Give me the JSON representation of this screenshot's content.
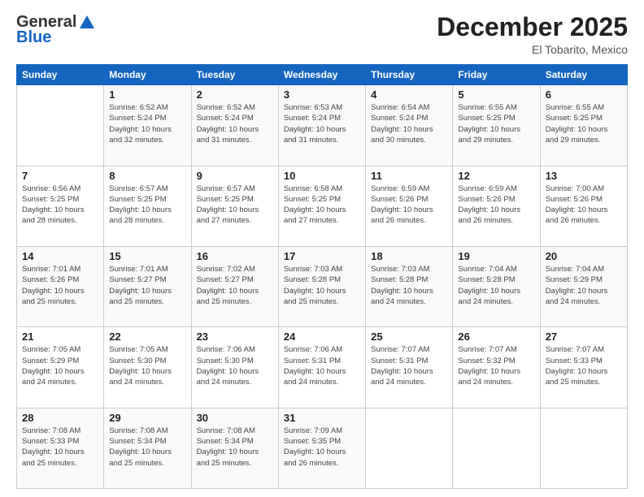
{
  "logo": {
    "general": "General",
    "blue": "Blue"
  },
  "header": {
    "title": "December 2025",
    "subtitle": "El Tobarito, Mexico"
  },
  "weekdays": [
    "Sunday",
    "Monday",
    "Tuesday",
    "Wednesday",
    "Thursday",
    "Friday",
    "Saturday"
  ],
  "weeks": [
    [
      {
        "day": "",
        "sunrise": "",
        "sunset": "",
        "daylight": ""
      },
      {
        "day": "1",
        "sunrise": "Sunrise: 6:52 AM",
        "sunset": "Sunset: 5:24 PM",
        "daylight": "Daylight: 10 hours and 32 minutes."
      },
      {
        "day": "2",
        "sunrise": "Sunrise: 6:52 AM",
        "sunset": "Sunset: 5:24 PM",
        "daylight": "Daylight: 10 hours and 31 minutes."
      },
      {
        "day": "3",
        "sunrise": "Sunrise: 6:53 AM",
        "sunset": "Sunset: 5:24 PM",
        "daylight": "Daylight: 10 hours and 31 minutes."
      },
      {
        "day": "4",
        "sunrise": "Sunrise: 6:54 AM",
        "sunset": "Sunset: 5:24 PM",
        "daylight": "Daylight: 10 hours and 30 minutes."
      },
      {
        "day": "5",
        "sunrise": "Sunrise: 6:55 AM",
        "sunset": "Sunset: 5:25 PM",
        "daylight": "Daylight: 10 hours and 29 minutes."
      },
      {
        "day": "6",
        "sunrise": "Sunrise: 6:55 AM",
        "sunset": "Sunset: 5:25 PM",
        "daylight": "Daylight: 10 hours and 29 minutes."
      }
    ],
    [
      {
        "day": "7",
        "sunrise": "Sunrise: 6:56 AM",
        "sunset": "Sunset: 5:25 PM",
        "daylight": "Daylight: 10 hours and 28 minutes."
      },
      {
        "day": "8",
        "sunrise": "Sunrise: 6:57 AM",
        "sunset": "Sunset: 5:25 PM",
        "daylight": "Daylight: 10 hours and 28 minutes."
      },
      {
        "day": "9",
        "sunrise": "Sunrise: 6:57 AM",
        "sunset": "Sunset: 5:25 PM",
        "daylight": "Daylight: 10 hours and 27 minutes."
      },
      {
        "day": "10",
        "sunrise": "Sunrise: 6:58 AM",
        "sunset": "Sunset: 5:25 PM",
        "daylight": "Daylight: 10 hours and 27 minutes."
      },
      {
        "day": "11",
        "sunrise": "Sunrise: 6:59 AM",
        "sunset": "Sunset: 5:26 PM",
        "daylight": "Daylight: 10 hours and 26 minutes."
      },
      {
        "day": "12",
        "sunrise": "Sunrise: 6:59 AM",
        "sunset": "Sunset: 5:26 PM",
        "daylight": "Daylight: 10 hours and 26 minutes."
      },
      {
        "day": "13",
        "sunrise": "Sunrise: 7:00 AM",
        "sunset": "Sunset: 5:26 PM",
        "daylight": "Daylight: 10 hours and 26 minutes."
      }
    ],
    [
      {
        "day": "14",
        "sunrise": "Sunrise: 7:01 AM",
        "sunset": "Sunset: 5:26 PM",
        "daylight": "Daylight: 10 hours and 25 minutes."
      },
      {
        "day": "15",
        "sunrise": "Sunrise: 7:01 AM",
        "sunset": "Sunset: 5:27 PM",
        "daylight": "Daylight: 10 hours and 25 minutes."
      },
      {
        "day": "16",
        "sunrise": "Sunrise: 7:02 AM",
        "sunset": "Sunset: 5:27 PM",
        "daylight": "Daylight: 10 hours and 25 minutes."
      },
      {
        "day": "17",
        "sunrise": "Sunrise: 7:03 AM",
        "sunset": "Sunset: 5:28 PM",
        "daylight": "Daylight: 10 hours and 25 minutes."
      },
      {
        "day": "18",
        "sunrise": "Sunrise: 7:03 AM",
        "sunset": "Sunset: 5:28 PM",
        "daylight": "Daylight: 10 hours and 24 minutes."
      },
      {
        "day": "19",
        "sunrise": "Sunrise: 7:04 AM",
        "sunset": "Sunset: 5:28 PM",
        "daylight": "Daylight: 10 hours and 24 minutes."
      },
      {
        "day": "20",
        "sunrise": "Sunrise: 7:04 AM",
        "sunset": "Sunset: 5:29 PM",
        "daylight": "Daylight: 10 hours and 24 minutes."
      }
    ],
    [
      {
        "day": "21",
        "sunrise": "Sunrise: 7:05 AM",
        "sunset": "Sunset: 5:29 PM",
        "daylight": "Daylight: 10 hours and 24 minutes."
      },
      {
        "day": "22",
        "sunrise": "Sunrise: 7:05 AM",
        "sunset": "Sunset: 5:30 PM",
        "daylight": "Daylight: 10 hours and 24 minutes."
      },
      {
        "day": "23",
        "sunrise": "Sunrise: 7:06 AM",
        "sunset": "Sunset: 5:30 PM",
        "daylight": "Daylight: 10 hours and 24 minutes."
      },
      {
        "day": "24",
        "sunrise": "Sunrise: 7:06 AM",
        "sunset": "Sunset: 5:31 PM",
        "daylight": "Daylight: 10 hours and 24 minutes."
      },
      {
        "day": "25",
        "sunrise": "Sunrise: 7:07 AM",
        "sunset": "Sunset: 5:31 PM",
        "daylight": "Daylight: 10 hours and 24 minutes."
      },
      {
        "day": "26",
        "sunrise": "Sunrise: 7:07 AM",
        "sunset": "Sunset: 5:32 PM",
        "daylight": "Daylight: 10 hours and 24 minutes."
      },
      {
        "day": "27",
        "sunrise": "Sunrise: 7:07 AM",
        "sunset": "Sunset: 5:33 PM",
        "daylight": "Daylight: 10 hours and 25 minutes."
      }
    ],
    [
      {
        "day": "28",
        "sunrise": "Sunrise: 7:08 AM",
        "sunset": "Sunset: 5:33 PM",
        "daylight": "Daylight: 10 hours and 25 minutes."
      },
      {
        "day": "29",
        "sunrise": "Sunrise: 7:08 AM",
        "sunset": "Sunset: 5:34 PM",
        "daylight": "Daylight: 10 hours and 25 minutes."
      },
      {
        "day": "30",
        "sunrise": "Sunrise: 7:08 AM",
        "sunset": "Sunset: 5:34 PM",
        "daylight": "Daylight: 10 hours and 25 minutes."
      },
      {
        "day": "31",
        "sunrise": "Sunrise: 7:09 AM",
        "sunset": "Sunset: 5:35 PM",
        "daylight": "Daylight: 10 hours and 26 minutes."
      },
      {
        "day": "",
        "sunrise": "",
        "sunset": "",
        "daylight": ""
      },
      {
        "day": "",
        "sunrise": "",
        "sunset": "",
        "daylight": ""
      },
      {
        "day": "",
        "sunrise": "",
        "sunset": "",
        "daylight": ""
      }
    ]
  ]
}
